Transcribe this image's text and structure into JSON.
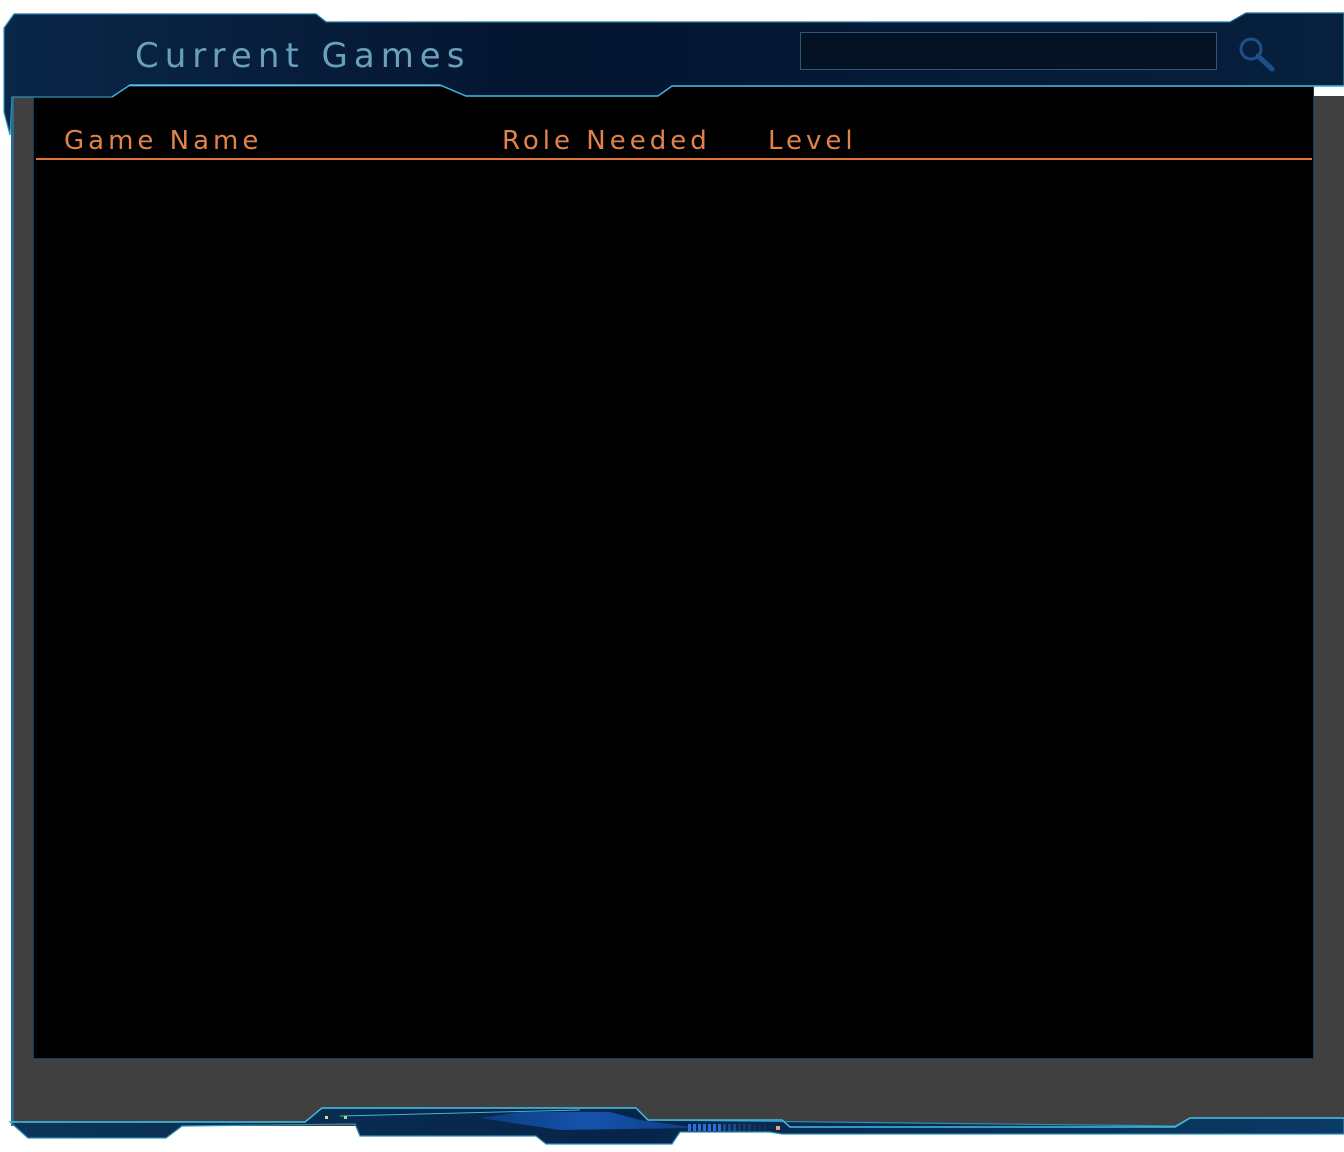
{
  "window": {
    "title": "Current Games"
  },
  "search": {
    "value": "",
    "placeholder": "",
    "icon": "search-icon"
  },
  "table": {
    "columns": [
      "Game Name",
      "Role Needed",
      "Level"
    ],
    "rows": []
  },
  "colors": {
    "title_text": "#6aa0bb",
    "header_text": "#e0824a",
    "header_rule": "#e0733a",
    "panel_bg": "#000000",
    "frame_bg": "#404040",
    "chrome_dark": "#04142b",
    "chrome_edge": "#3aa6c8",
    "accent_blue": "#1a5aa6"
  }
}
